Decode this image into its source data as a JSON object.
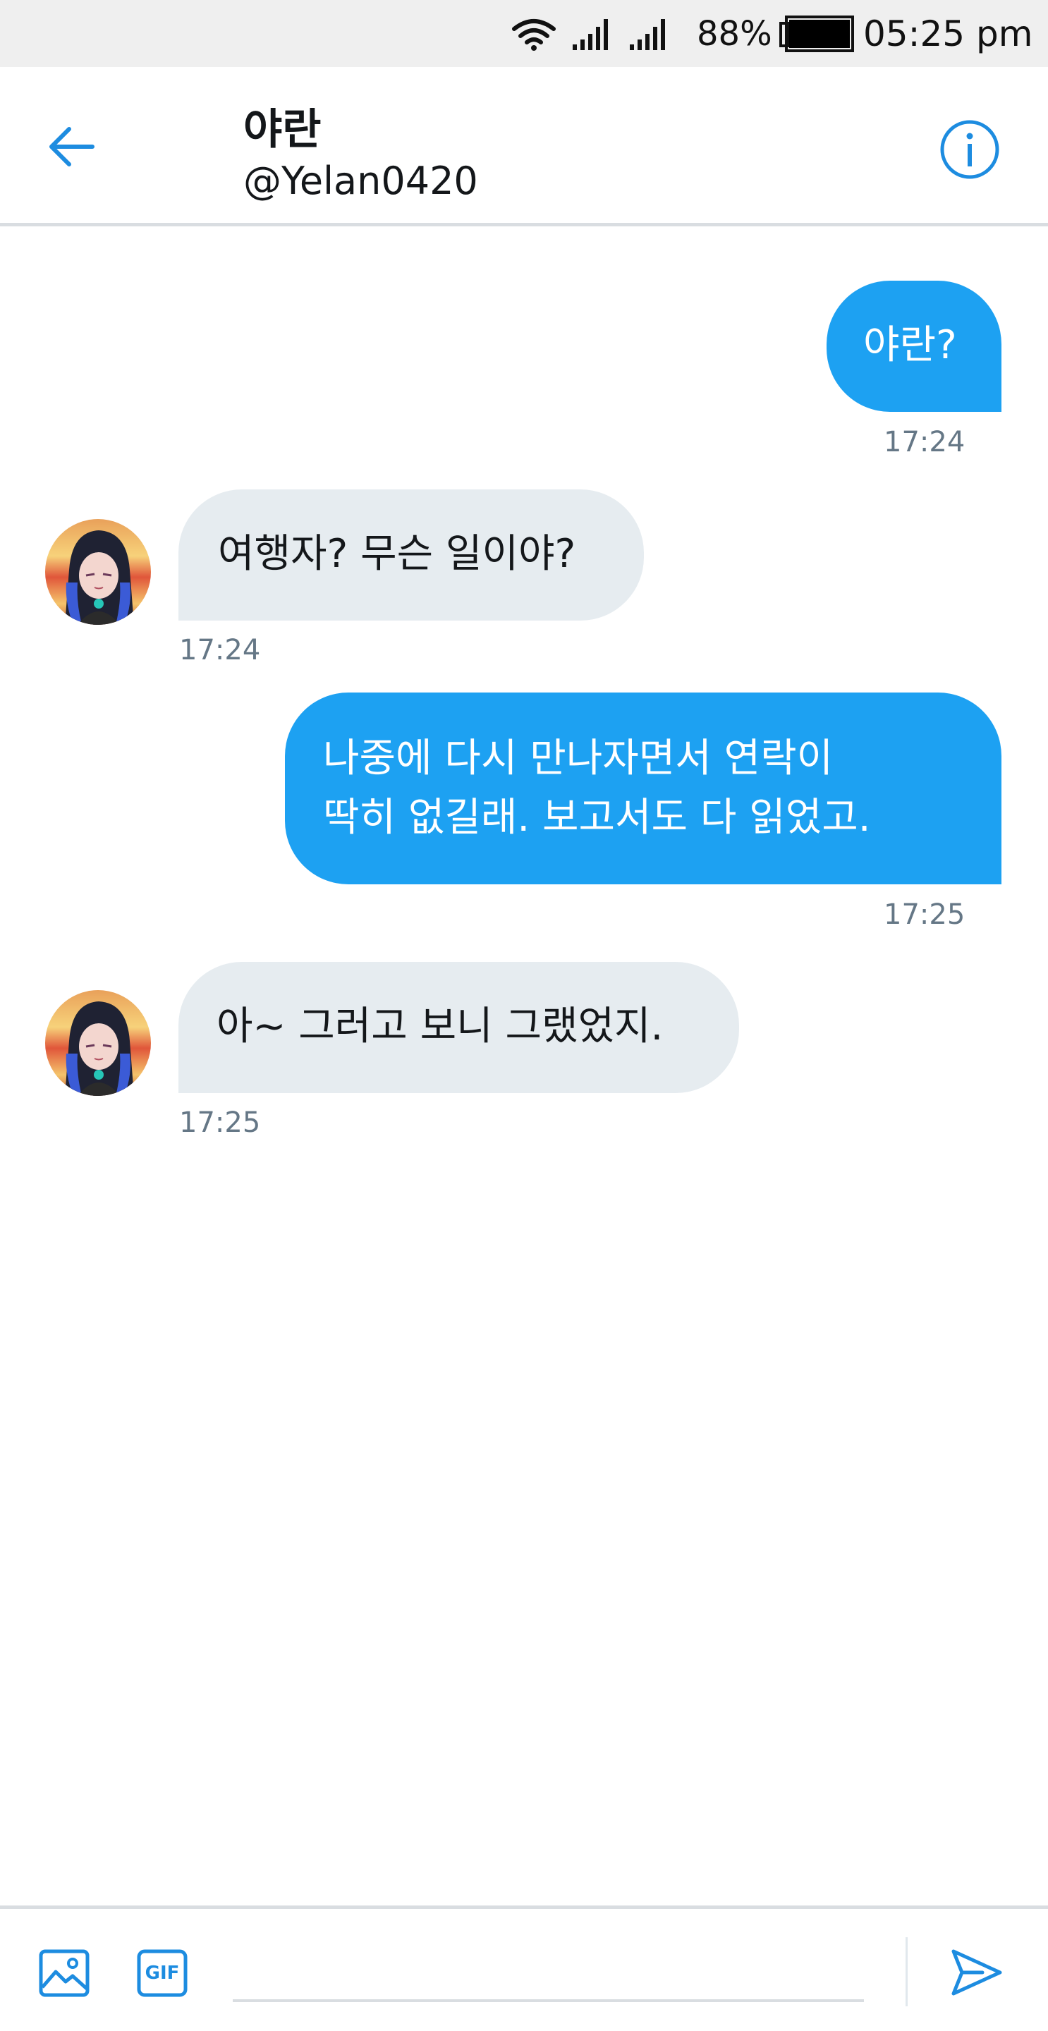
{
  "status_bar": {
    "wifi_icon": "wifi-icon",
    "signal_icons": [
      "signal-icon",
      "signal-icon"
    ],
    "battery_percent": "88%",
    "battery_level": 0.88,
    "time": "05:25 pm"
  },
  "header": {
    "back_icon": "arrow-left-icon",
    "name": "야란",
    "handle": "@Yelan0420",
    "info_icon": "info-icon",
    "accent_color": "#1da1f2"
  },
  "messages": [
    {
      "direction": "sent",
      "text": "야란?",
      "time": "17:24"
    },
    {
      "direction": "received",
      "text": "여행자? 무슨 일이야?",
      "time": "17:24"
    },
    {
      "direction": "sent",
      "lines": [
        "나중에 다시 만나자면서 연락이",
        "딱히 없길래. 보고서도 다 읽었고."
      ],
      "time": "17:25"
    },
    {
      "direction": "received",
      "text": "아~ 그러고 보니 그랬었지.",
      "time": "17:25"
    }
  ],
  "composer": {
    "image_icon": "image-icon",
    "gif_label": "GIF",
    "input_value": "",
    "send_icon": "send-icon"
  },
  "colors": {
    "sent_bubble": "#1da1f2",
    "received_bubble": "#e6ecf0",
    "timestamp": "#657786"
  }
}
